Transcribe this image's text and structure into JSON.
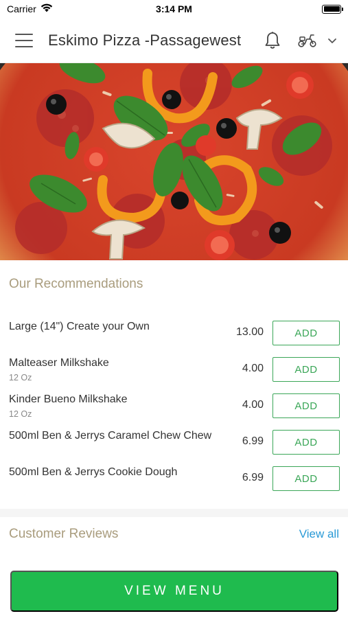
{
  "status_bar": {
    "carrier": "Carrier",
    "time": "3:14 PM",
    "wifi_icon": "wifi-icon",
    "battery_icon": "battery-icon"
  },
  "nav": {
    "title": "Eskimo Pizza -Passagewest",
    "menu_icon": "hamburger-icon",
    "bell_icon": "bell-icon",
    "delivery_icon": "scooter-icon",
    "dropdown_icon": "chevron-down-icon"
  },
  "hero": {
    "image": "pizza-photo"
  },
  "recommendations": {
    "title": "Our Recommendations",
    "items": [
      {
        "name": "Large (14\") Create your Own",
        "sub": "",
        "price": "13.00",
        "add_label": "ADD"
      },
      {
        "name": "Malteaser Milkshake",
        "sub": "12 Oz",
        "price": "4.00",
        "add_label": "ADD"
      },
      {
        "name": "Kinder Bueno Milkshake",
        "sub": "12 Oz",
        "price": "4.00",
        "add_label": "ADD"
      },
      {
        "name": "500ml Ben & Jerrys Caramel Chew Chew",
        "sub": "",
        "price": "6.99",
        "add_label": "ADD"
      },
      {
        "name": "500ml Ben & Jerrys Cookie Dough",
        "sub": "",
        "price": "6.99",
        "add_label": "ADD"
      }
    ]
  },
  "reviews": {
    "title": "Customer Reviews",
    "view_all": "View all"
  },
  "footer": {
    "view_menu": "VIEW MENU"
  },
  "colors": {
    "accent_green": "#1fbb4e",
    "add_border": "#3aa657",
    "section_title": "#a99c7d",
    "link_blue": "#2a9ad6"
  }
}
